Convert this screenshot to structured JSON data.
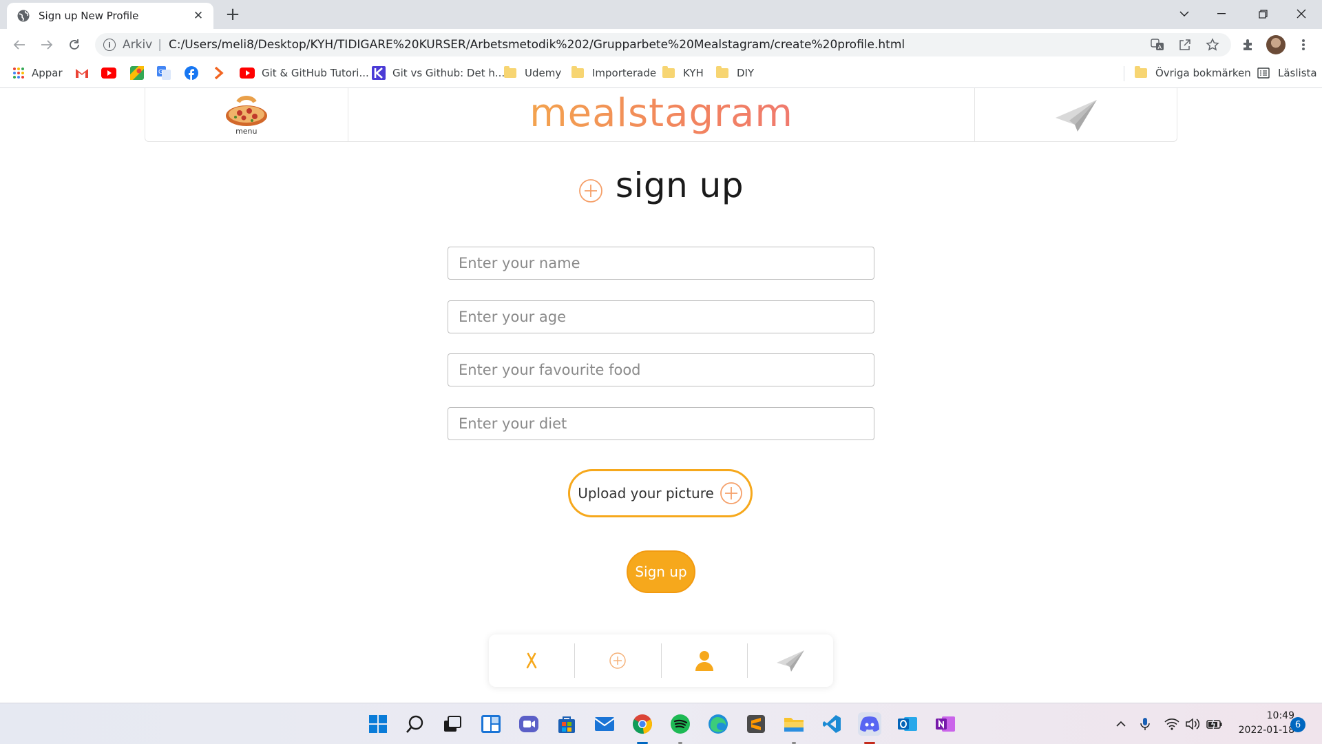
{
  "browser": {
    "tab_title": "Sign up New Profile",
    "omnibox": {
      "scheme_label": "Arkiv",
      "separator": "|",
      "url": "C:/Users/meli8/Desktop/KYH/TIDIGARE%20KURSER/Arbetsmetodik%202/Grupparbete%20Mealstagram/create%20profile.html"
    },
    "bookmarks": {
      "apps": "Appar",
      "git_github_tutorial": "Git & GitHub Tutori...",
      "git_vs_github": "Git vs Github: Det h...",
      "udemy": "Udemy",
      "importerade": "Importerade",
      "kyh": "KYH",
      "diy": "DIY",
      "other": "Övriga bokmärken",
      "reading_list": "Läslista"
    }
  },
  "header": {
    "menu_label": "menu",
    "brand": "mealstagram"
  },
  "main": {
    "title": "sign up",
    "fields": {
      "name_placeholder": "Enter your name",
      "age_placeholder": "Enter your age",
      "food_placeholder": "Enter your favourite food",
      "diet_placeholder": "Enter your diet"
    },
    "upload_label": "Upload your picture",
    "signup_label": "Sign up"
  },
  "colors": {
    "accent": "#f6a81c",
    "brand_start": "#f3a34e",
    "brand_end": "#f07a6e"
  },
  "taskbar": {
    "time": "10:49",
    "date": "2022-01-18",
    "notifications": "6"
  }
}
